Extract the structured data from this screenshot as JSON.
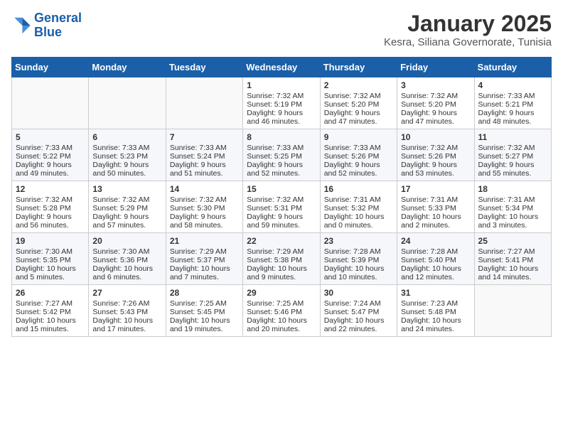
{
  "header": {
    "logo_line1": "General",
    "logo_line2": "Blue",
    "title": "January 2025",
    "subtitle": "Kesra, Siliana Governorate, Tunisia"
  },
  "days_of_week": [
    "Sunday",
    "Monday",
    "Tuesday",
    "Wednesday",
    "Thursday",
    "Friday",
    "Saturday"
  ],
  "weeks": [
    [
      {
        "day": "",
        "data": ""
      },
      {
        "day": "",
        "data": ""
      },
      {
        "day": "",
        "data": ""
      },
      {
        "day": "1",
        "data": "Sunrise: 7:32 AM\nSunset: 5:19 PM\nDaylight: 9 hours and 46 minutes."
      },
      {
        "day": "2",
        "data": "Sunrise: 7:32 AM\nSunset: 5:20 PM\nDaylight: 9 hours and 47 minutes."
      },
      {
        "day": "3",
        "data": "Sunrise: 7:32 AM\nSunset: 5:20 PM\nDaylight: 9 hours and 47 minutes."
      },
      {
        "day": "4",
        "data": "Sunrise: 7:33 AM\nSunset: 5:21 PM\nDaylight: 9 hours and 48 minutes."
      }
    ],
    [
      {
        "day": "5",
        "data": "Sunrise: 7:33 AM\nSunset: 5:22 PM\nDaylight: 9 hours and 49 minutes."
      },
      {
        "day": "6",
        "data": "Sunrise: 7:33 AM\nSunset: 5:23 PM\nDaylight: 9 hours and 50 minutes."
      },
      {
        "day": "7",
        "data": "Sunrise: 7:33 AM\nSunset: 5:24 PM\nDaylight: 9 hours and 51 minutes."
      },
      {
        "day": "8",
        "data": "Sunrise: 7:33 AM\nSunset: 5:25 PM\nDaylight: 9 hours and 52 minutes."
      },
      {
        "day": "9",
        "data": "Sunrise: 7:33 AM\nSunset: 5:26 PM\nDaylight: 9 hours and 52 minutes."
      },
      {
        "day": "10",
        "data": "Sunrise: 7:32 AM\nSunset: 5:26 PM\nDaylight: 9 hours and 53 minutes."
      },
      {
        "day": "11",
        "data": "Sunrise: 7:32 AM\nSunset: 5:27 PM\nDaylight: 9 hours and 55 minutes."
      }
    ],
    [
      {
        "day": "12",
        "data": "Sunrise: 7:32 AM\nSunset: 5:28 PM\nDaylight: 9 hours and 56 minutes."
      },
      {
        "day": "13",
        "data": "Sunrise: 7:32 AM\nSunset: 5:29 PM\nDaylight: 9 hours and 57 minutes."
      },
      {
        "day": "14",
        "data": "Sunrise: 7:32 AM\nSunset: 5:30 PM\nDaylight: 9 hours and 58 minutes."
      },
      {
        "day": "15",
        "data": "Sunrise: 7:32 AM\nSunset: 5:31 PM\nDaylight: 9 hours and 59 minutes."
      },
      {
        "day": "16",
        "data": "Sunrise: 7:31 AM\nSunset: 5:32 PM\nDaylight: 10 hours and 0 minutes."
      },
      {
        "day": "17",
        "data": "Sunrise: 7:31 AM\nSunset: 5:33 PM\nDaylight: 10 hours and 2 minutes."
      },
      {
        "day": "18",
        "data": "Sunrise: 7:31 AM\nSunset: 5:34 PM\nDaylight: 10 hours and 3 minutes."
      }
    ],
    [
      {
        "day": "19",
        "data": "Sunrise: 7:30 AM\nSunset: 5:35 PM\nDaylight: 10 hours and 5 minutes."
      },
      {
        "day": "20",
        "data": "Sunrise: 7:30 AM\nSunset: 5:36 PM\nDaylight: 10 hours and 6 minutes."
      },
      {
        "day": "21",
        "data": "Sunrise: 7:29 AM\nSunset: 5:37 PM\nDaylight: 10 hours and 7 minutes."
      },
      {
        "day": "22",
        "data": "Sunrise: 7:29 AM\nSunset: 5:38 PM\nDaylight: 10 hours and 9 minutes."
      },
      {
        "day": "23",
        "data": "Sunrise: 7:28 AM\nSunset: 5:39 PM\nDaylight: 10 hours and 10 minutes."
      },
      {
        "day": "24",
        "data": "Sunrise: 7:28 AM\nSunset: 5:40 PM\nDaylight: 10 hours and 12 minutes."
      },
      {
        "day": "25",
        "data": "Sunrise: 7:27 AM\nSunset: 5:41 PM\nDaylight: 10 hours and 14 minutes."
      }
    ],
    [
      {
        "day": "26",
        "data": "Sunrise: 7:27 AM\nSunset: 5:42 PM\nDaylight: 10 hours and 15 minutes."
      },
      {
        "day": "27",
        "data": "Sunrise: 7:26 AM\nSunset: 5:43 PM\nDaylight: 10 hours and 17 minutes."
      },
      {
        "day": "28",
        "data": "Sunrise: 7:25 AM\nSunset: 5:45 PM\nDaylight: 10 hours and 19 minutes."
      },
      {
        "day": "29",
        "data": "Sunrise: 7:25 AM\nSunset: 5:46 PM\nDaylight: 10 hours and 20 minutes."
      },
      {
        "day": "30",
        "data": "Sunrise: 7:24 AM\nSunset: 5:47 PM\nDaylight: 10 hours and 22 minutes."
      },
      {
        "day": "31",
        "data": "Sunrise: 7:23 AM\nSunset: 5:48 PM\nDaylight: 10 hours and 24 minutes."
      },
      {
        "day": "",
        "data": ""
      }
    ]
  ]
}
